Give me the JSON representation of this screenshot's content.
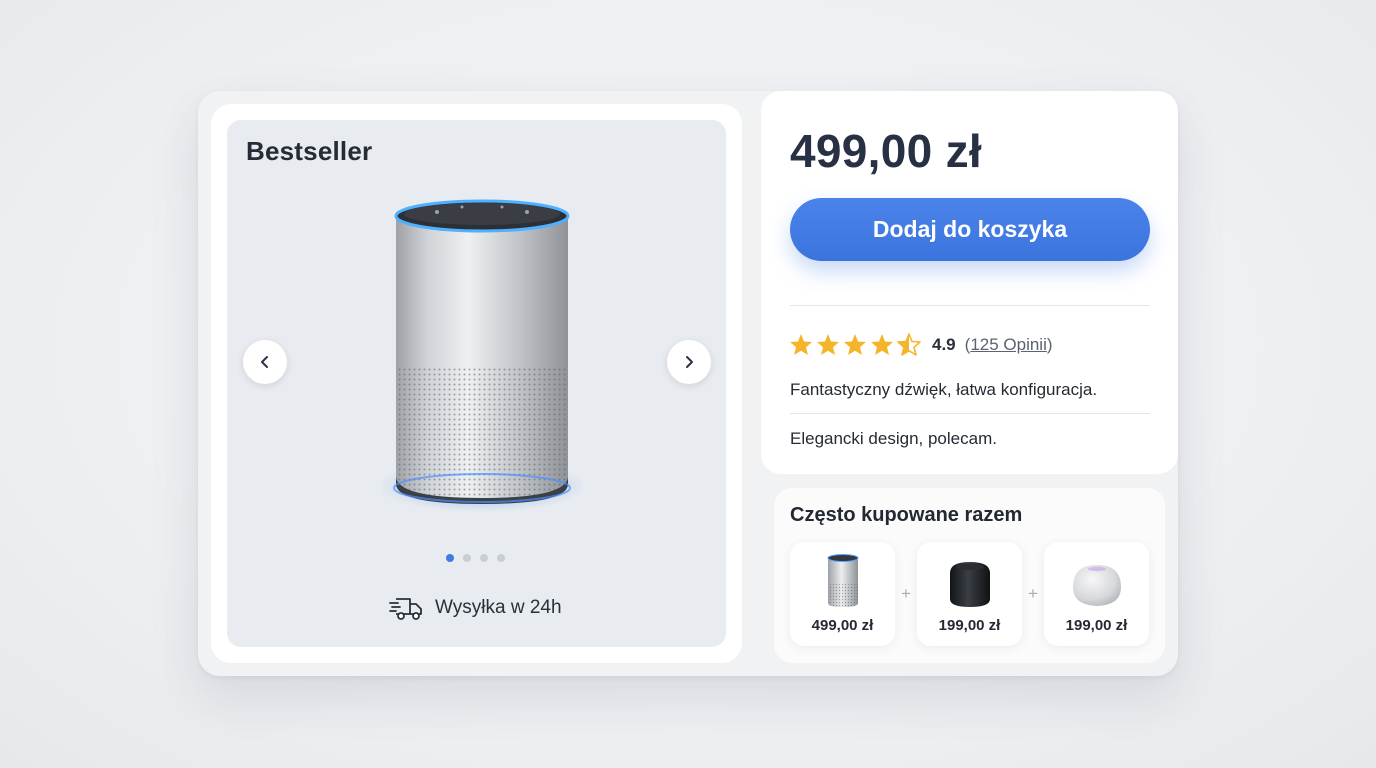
{
  "gallery": {
    "badge": "Bestseller",
    "image_count": 4,
    "active_index": 0,
    "shipping_text": "Wysyłka w 24h"
  },
  "buybox": {
    "price": "499,00 zł",
    "add_to_cart_label": "Dodaj do koszyka",
    "rating_value": "4.9",
    "rating_stars": 4.5,
    "reviews_prefix": "(",
    "reviews_link": "125 Opinii",
    "reviews_suffix": ")",
    "review_snippets": [
      "Fantastyczny dźwięk, łatwa konfiguracja.",
      "Elegancki design, polecam."
    ]
  },
  "bundle": {
    "title": "Często kupowane razem",
    "items": [
      {
        "price": "499,00 zł",
        "icon": "silver-speaker-icon"
      },
      {
        "price": "199,00 zł",
        "icon": "black-speaker-icon"
      },
      {
        "price": "199,00 zł",
        "icon": "white-speaker-icon"
      }
    ],
    "separator": "+"
  },
  "colors": {
    "accent": "#3f7be0",
    "star": "#f5b52a",
    "text": "#283044"
  }
}
